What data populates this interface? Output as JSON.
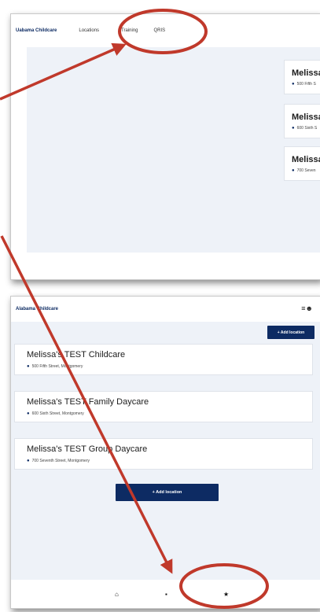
{
  "top": {
    "brand": "Uabama Childcare",
    "nav": [
      "Locations",
      "Training",
      "QRIS"
    ],
    "cards": [
      {
        "name": "Melissa's",
        "address": "500 Fifth S"
      },
      {
        "name": "Melissa's",
        "address": "600 Sixth S"
      },
      {
        "name": "Melissa's",
        "address": "700 Seven"
      }
    ]
  },
  "bottom": {
    "brand": "Alabama Childcare",
    "menu_icons": "≡☻",
    "add_location_top": "+  Add location",
    "cards": [
      {
        "name": "Melissa's TEST Childcare",
        "address": "500 Fifth Street, Montgomery"
      },
      {
        "name": "Melissa's TEST Family Daycare",
        "address": "600 Sixth Street, Montgomery"
      },
      {
        "name": "Melissa's TEST Group Daycare",
        "address": "700 Seventh Street, Montgomery"
      }
    ],
    "add_location_main": "+  Add location",
    "footer": {
      "home": "⌂",
      "book": "▪",
      "star": "★"
    }
  },
  "colors": {
    "brand": "#0d2b63",
    "annotation": "#c0392b",
    "content_bg": "#eef2f8"
  }
}
